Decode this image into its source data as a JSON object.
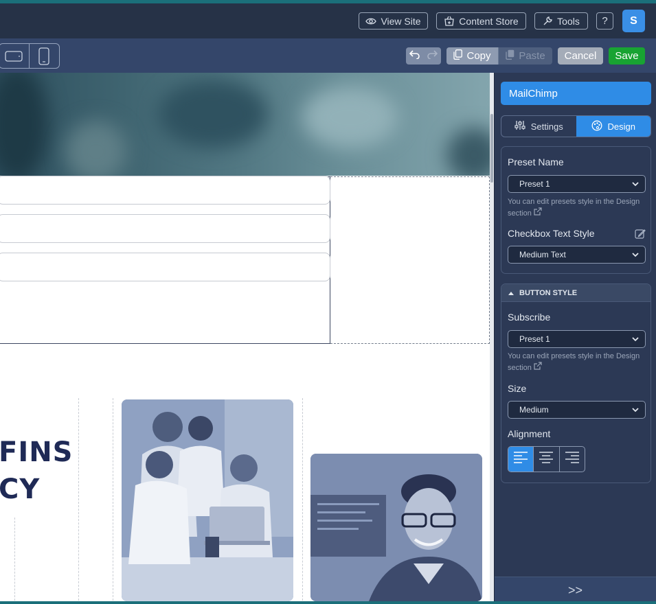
{
  "topbar": {
    "view_site": "View Site",
    "content_store": "Content Store",
    "tools": "Tools",
    "help": "?",
    "avatar_initial": "S"
  },
  "toolbar": {
    "copy": "Copy",
    "paste": "Paste",
    "cancel": "Cancel",
    "save": "Save"
  },
  "canvas": {
    "heading_line1": "FINS",
    "heading_line2": "CY"
  },
  "panel": {
    "title": "MailChimp",
    "tabs": [
      {
        "label": "Settings",
        "icon": "sliders-icon",
        "active": false
      },
      {
        "label": "Design",
        "icon": "palette-icon",
        "active": true
      }
    ],
    "preset_name_label": "Preset Name",
    "preset_name_value": "Preset 1",
    "preset_hint": "You can edit presets style in the Design section",
    "checkbox_text_style_label": "Checkbox Text Style",
    "checkbox_text_style_value": "Medium Text",
    "button_style_header": "BUTTON STYLE",
    "subscribe_label": "Subscribe",
    "subscribe_value": "Preset 1",
    "subscribe_hint": "You can edit presets style in the Design section",
    "size_label": "Size",
    "size_value": "Medium",
    "alignment_label": "Alignment",
    "alignment_options": [
      "left",
      "center",
      "right"
    ],
    "alignment_selected": "left",
    "footer_toggle": ">>"
  },
  "colors": {
    "topbar_bg": "#263247",
    "toolbar_bg": "#34466a",
    "panel_bg": "#2c3955",
    "accent_blue": "#2f8ce6",
    "save_green": "#18a332",
    "heading_navy": "#1f2a56"
  }
}
